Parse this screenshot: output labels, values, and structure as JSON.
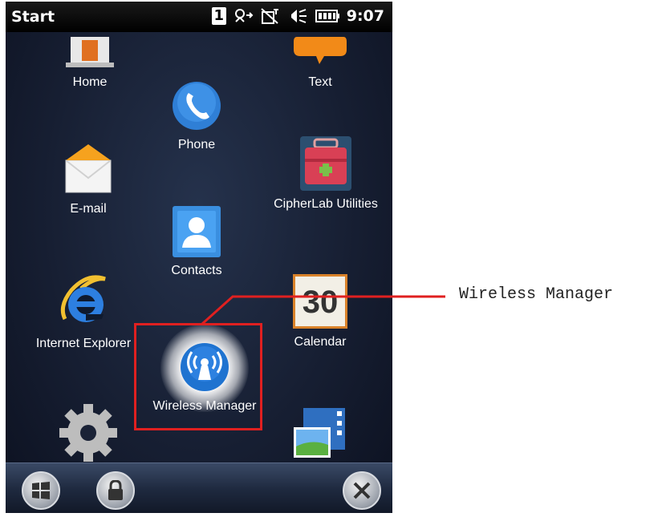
{
  "status_bar": {
    "title": "Start",
    "notification_count": "1",
    "time": "9:07"
  },
  "apps": [
    {
      "label": "Home",
      "icon": "home-icon"
    },
    {
      "label": "Text",
      "icon": "text-message-icon"
    },
    {
      "label": "Phone",
      "icon": "phone-icon"
    },
    {
      "label": "E-mail",
      "icon": "email-icon"
    },
    {
      "label": "CipherLab Utilities",
      "icon": "toolbox-icon"
    },
    {
      "label": "Contacts",
      "icon": "contacts-icon"
    },
    {
      "label": "Internet Explorer",
      "icon": "internet-explorer-icon"
    },
    {
      "label": "Calendar",
      "icon": "calendar-icon",
      "day": "30"
    },
    {
      "label": "Wireless Manager",
      "icon": "wireless-icon"
    },
    {
      "label": "",
      "icon": "settings-gear-icon"
    },
    {
      "label": "",
      "icon": "pictures-videos-icon"
    }
  ],
  "taskbar": {
    "buttons": [
      "windows-start-icon",
      "lock-icon",
      "close-icon"
    ]
  },
  "annotation": {
    "label": "Wireless Manager",
    "color": "#e02020"
  }
}
